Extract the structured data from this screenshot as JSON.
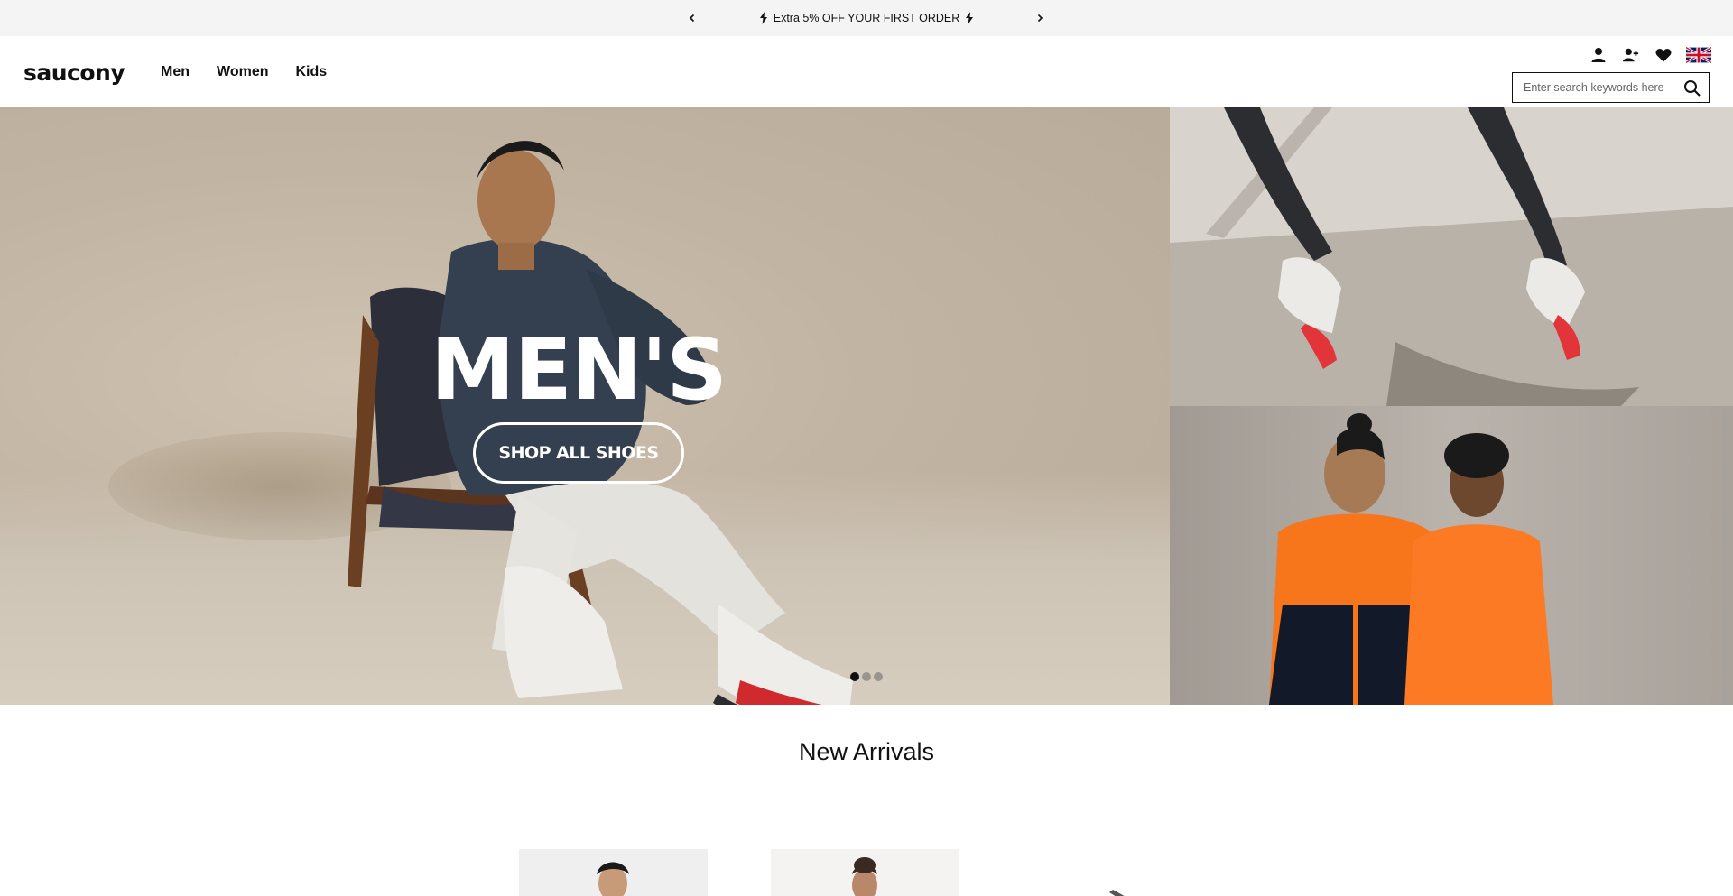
{
  "promo": {
    "message": "Extra 5% OFF YOUR FIRST ORDER"
  },
  "header": {
    "logo_text": "saucony",
    "nav": [
      "Men",
      "Women",
      "Kids"
    ],
    "search": {
      "placeholder": "Enter search keywords here",
      "value": ""
    },
    "utility_icons": [
      "account-icon",
      "register-icon",
      "wishlist-icon",
      "uk-flag-icon"
    ]
  },
  "hero": {
    "headline": "MEN'S",
    "cta_label": "SHOP ALL SHOES",
    "slide_count": 3,
    "active_slide": 1
  },
  "new_arrivals": {
    "title": "New Arrivals"
  },
  "colors": {
    "promo_bg": "#f4f4f4",
    "text": "#111111",
    "hero_bg": "#c2b4a2",
    "accent_orange": "#f7761c",
    "shoe_red": "#d3222a"
  }
}
